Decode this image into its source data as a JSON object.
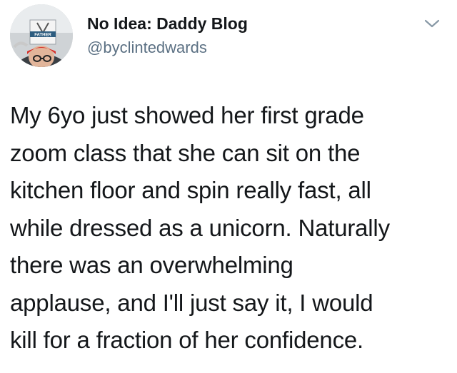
{
  "author": {
    "display_name": "No Idea: Daddy Blog",
    "handle": "@byclintedwards",
    "avatar_sign_text": "FATHER"
  },
  "menu": {
    "icon": "chevron-down-icon"
  },
  "tweet": {
    "lines": [
      "My 6yo just showed her first grade",
      "zoom class that she can sit on the",
      "kitchen floor and spin really fast, all",
      "while dressed as a unicorn. Naturally",
      "there was an overwhelming",
      "applause, and I'll just say it, I would",
      "kill for a fraction of her confidence."
    ]
  },
  "colors": {
    "text_primary": "#14171a",
    "text_secondary": "#5b7083",
    "background": "#ffffff"
  }
}
